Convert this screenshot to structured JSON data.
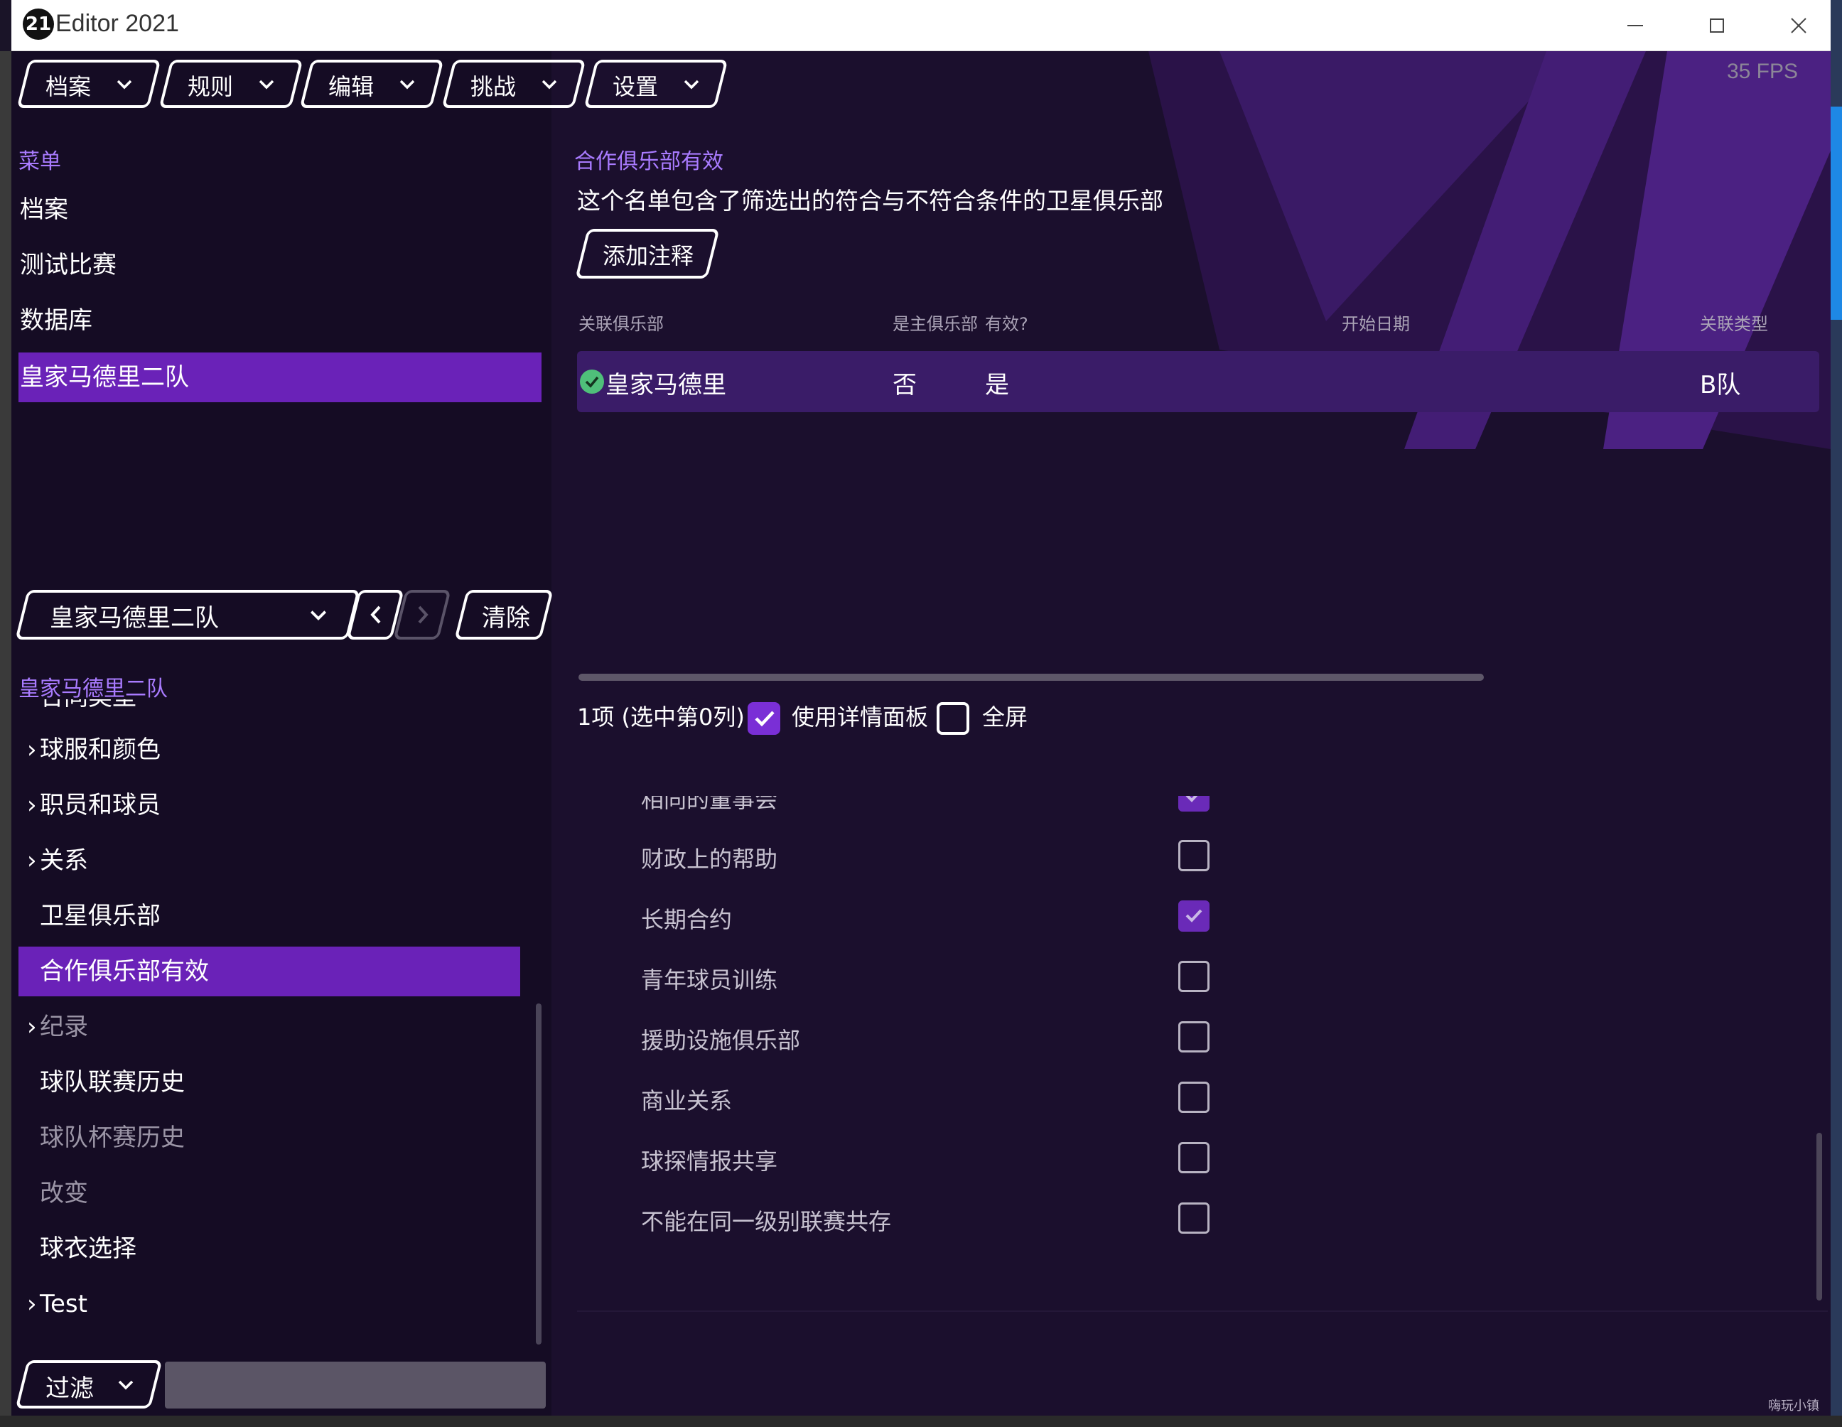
{
  "window": {
    "logo_text": "21",
    "title": "Editor 2021",
    "fps": "35 FPS"
  },
  "menu": [
    {
      "label": "档案"
    },
    {
      "label": "规则"
    },
    {
      "label": "编辑"
    },
    {
      "label": "挑战"
    },
    {
      "label": "设置"
    }
  ],
  "sidebar": {
    "section_label": "菜单",
    "items": [
      {
        "label": "档案"
      },
      {
        "label": "测试比赛"
      },
      {
        "label": "数据库"
      },
      {
        "label": "皇家马德里二队"
      }
    ],
    "selector_value": "皇家马德里二队",
    "clear_label": "清除",
    "tree_section_label": "皇家马德里二队",
    "tree_partial": "合同类型",
    "tree": [
      {
        "label": "球服和颜色",
        "expandable": true
      },
      {
        "label": "职员和球员",
        "expandable": true
      },
      {
        "label": "关系",
        "expandable": true
      },
      {
        "label": "卫星俱乐部"
      },
      {
        "label": "合作俱乐部有效",
        "active": true
      },
      {
        "label": "纪录",
        "expandable": true,
        "dim": true
      },
      {
        "label": "球队联赛历史"
      },
      {
        "label": "球队杯赛历史",
        "dim": true
      },
      {
        "label": "改变",
        "dim": true
      },
      {
        "label": "球衣选择"
      },
      {
        "label": "Test",
        "expandable": true
      }
    ],
    "filter_label": "过滤"
  },
  "main": {
    "title": "合作俱乐部有效",
    "description": "这个名单包含了筛选出的符合与不符合条件的卫星俱乐部",
    "add_note_label": "添加注释",
    "columns": [
      "关联俱乐部",
      "是主俱乐部",
      "有效?",
      "开始日期",
      "关联类型"
    ],
    "row": {
      "club": "皇家马德里",
      "is_main": "否",
      "valid": "是",
      "start_date": "",
      "type": "B队"
    },
    "status": "1项 (选中第0列)",
    "use_detail_panel_label": "使用详情面板",
    "use_detail_panel_checked": true,
    "fullscreen_label": "全屏",
    "fullscreen_checked": false,
    "details_partial": "相同的董事会",
    "details": [
      {
        "label": "财政上的帮助",
        "checked": false
      },
      {
        "label": "长期合约",
        "checked": true
      },
      {
        "label": "青年球员训练",
        "checked": false
      },
      {
        "label": "援助设施俱乐部",
        "checked": false
      },
      {
        "label": "商业关系",
        "checked": false
      },
      {
        "label": "球探情报共享",
        "checked": false
      },
      {
        "label": "不能在同一级别联赛共存",
        "checked": false
      }
    ]
  },
  "watermark": "嗨玩小镇",
  "colors": {
    "accent": "#6a22b8",
    "accent_text": "#a97bff",
    "background": "#1b0f2d"
  }
}
